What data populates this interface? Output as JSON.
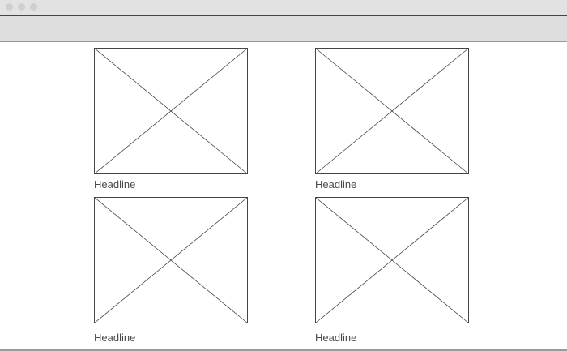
{
  "window": {
    "controls": [
      "close",
      "minimize",
      "zoom"
    ]
  },
  "cards": [
    {
      "headline": "Headline",
      "image": "image-placeholder"
    },
    {
      "headline": "Headline",
      "image": "image-placeholder"
    },
    {
      "headline": "Headline",
      "image": "image-placeholder"
    },
    {
      "headline": "Headline",
      "image": "image-placeholder"
    }
  ],
  "colors": {
    "titlebar": "#e2e2e2",
    "toolbar": "#dedede",
    "border": "#444444",
    "text": "#4a4a4a"
  }
}
